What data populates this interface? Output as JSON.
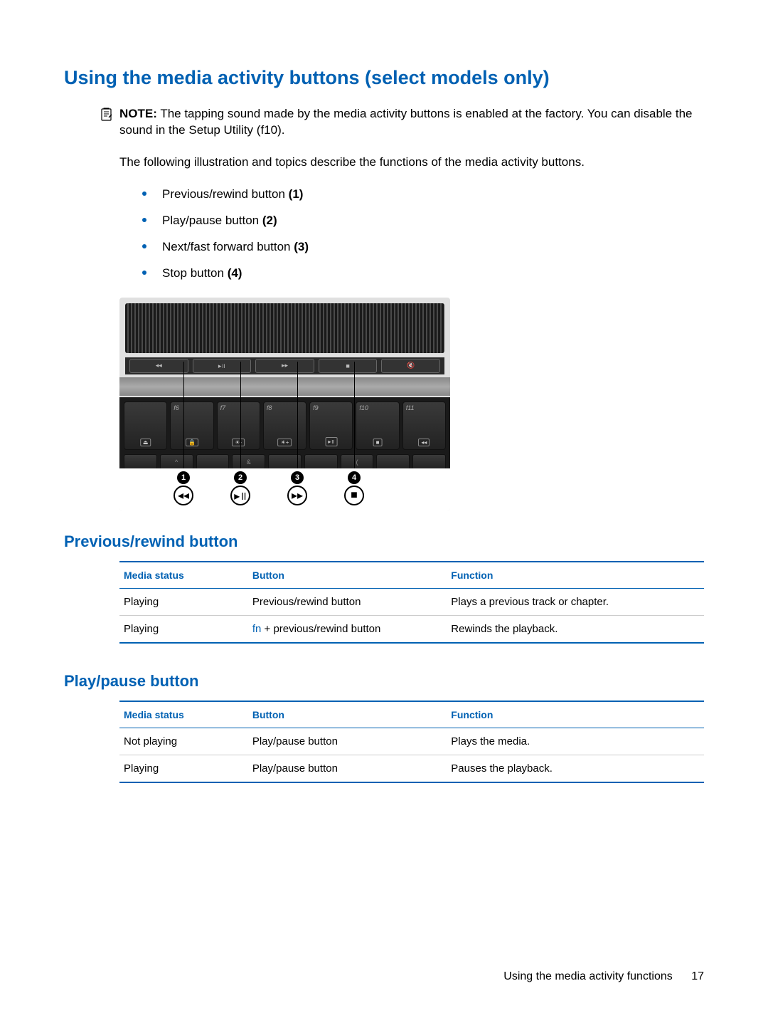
{
  "heading": "Using the media activity buttons (select models only)",
  "note": {
    "label": "NOTE:",
    "text": "The tapping sound made by the media activity buttons is enabled at the factory. You can disable the sound in the Setup Utility (f10)."
  },
  "intro": "The following illustration and topics describe the functions of the media activity buttons.",
  "bullets": [
    {
      "text": "Previous/rewind button ",
      "bold": "(1)"
    },
    {
      "text": "Play/pause button ",
      "bold": "(2)"
    },
    {
      "text": "Next/fast forward button ",
      "bold": "(3)"
    },
    {
      "text": "Stop button ",
      "bold": "(4)"
    }
  ],
  "illustration": {
    "media_bar_labels": [
      "◂◂",
      "▸॥",
      "▸▸",
      "■",
      "🔇"
    ],
    "keys": [
      {
        "fn": "",
        "sub": "⏏"
      },
      {
        "fn": "f6",
        "sub": "🔒"
      },
      {
        "fn": "f7",
        "sub": "☀-"
      },
      {
        "fn": "f8",
        "sub": "☀+"
      },
      {
        "fn": "f9",
        "sub": "▸॥"
      },
      {
        "fn": "f10",
        "sub": "■"
      },
      {
        "fn": "f11",
        "sub": "◂◂"
      }
    ],
    "row2": [
      "",
      "^",
      "",
      "&",
      "",
      "",
      "(",
      "",
      ""
    ],
    "callouts": [
      {
        "num": "1",
        "icon": "◂◂"
      },
      {
        "num": "2",
        "icon": "▸॥"
      },
      {
        "num": "3",
        "icon": "▸▸"
      },
      {
        "num": "4",
        "icon": "■"
      }
    ]
  },
  "section_prev": {
    "title": "Previous/rewind button",
    "headers": [
      "Media status",
      "Button",
      "Function"
    ],
    "rows": [
      {
        "status": "Playing",
        "button_prefix": "",
        "button": "Previous/rewind button",
        "function": "Plays a previous track or chapter."
      },
      {
        "status": "Playing",
        "button_prefix": "fn",
        "button": " + previous/rewind button",
        "function": "Rewinds the playback."
      }
    ]
  },
  "section_play": {
    "title": "Play/pause button",
    "headers": [
      "Media status",
      "Button",
      "Function"
    ],
    "rows": [
      {
        "status": "Not playing",
        "button_prefix": "",
        "button": "Play/pause button",
        "function": "Plays the media."
      },
      {
        "status": "Playing",
        "button_prefix": "",
        "button": "Play/pause button",
        "function": "Pauses the playback."
      }
    ]
  },
  "footer": {
    "text": "Using the media activity functions",
    "page": "17"
  }
}
